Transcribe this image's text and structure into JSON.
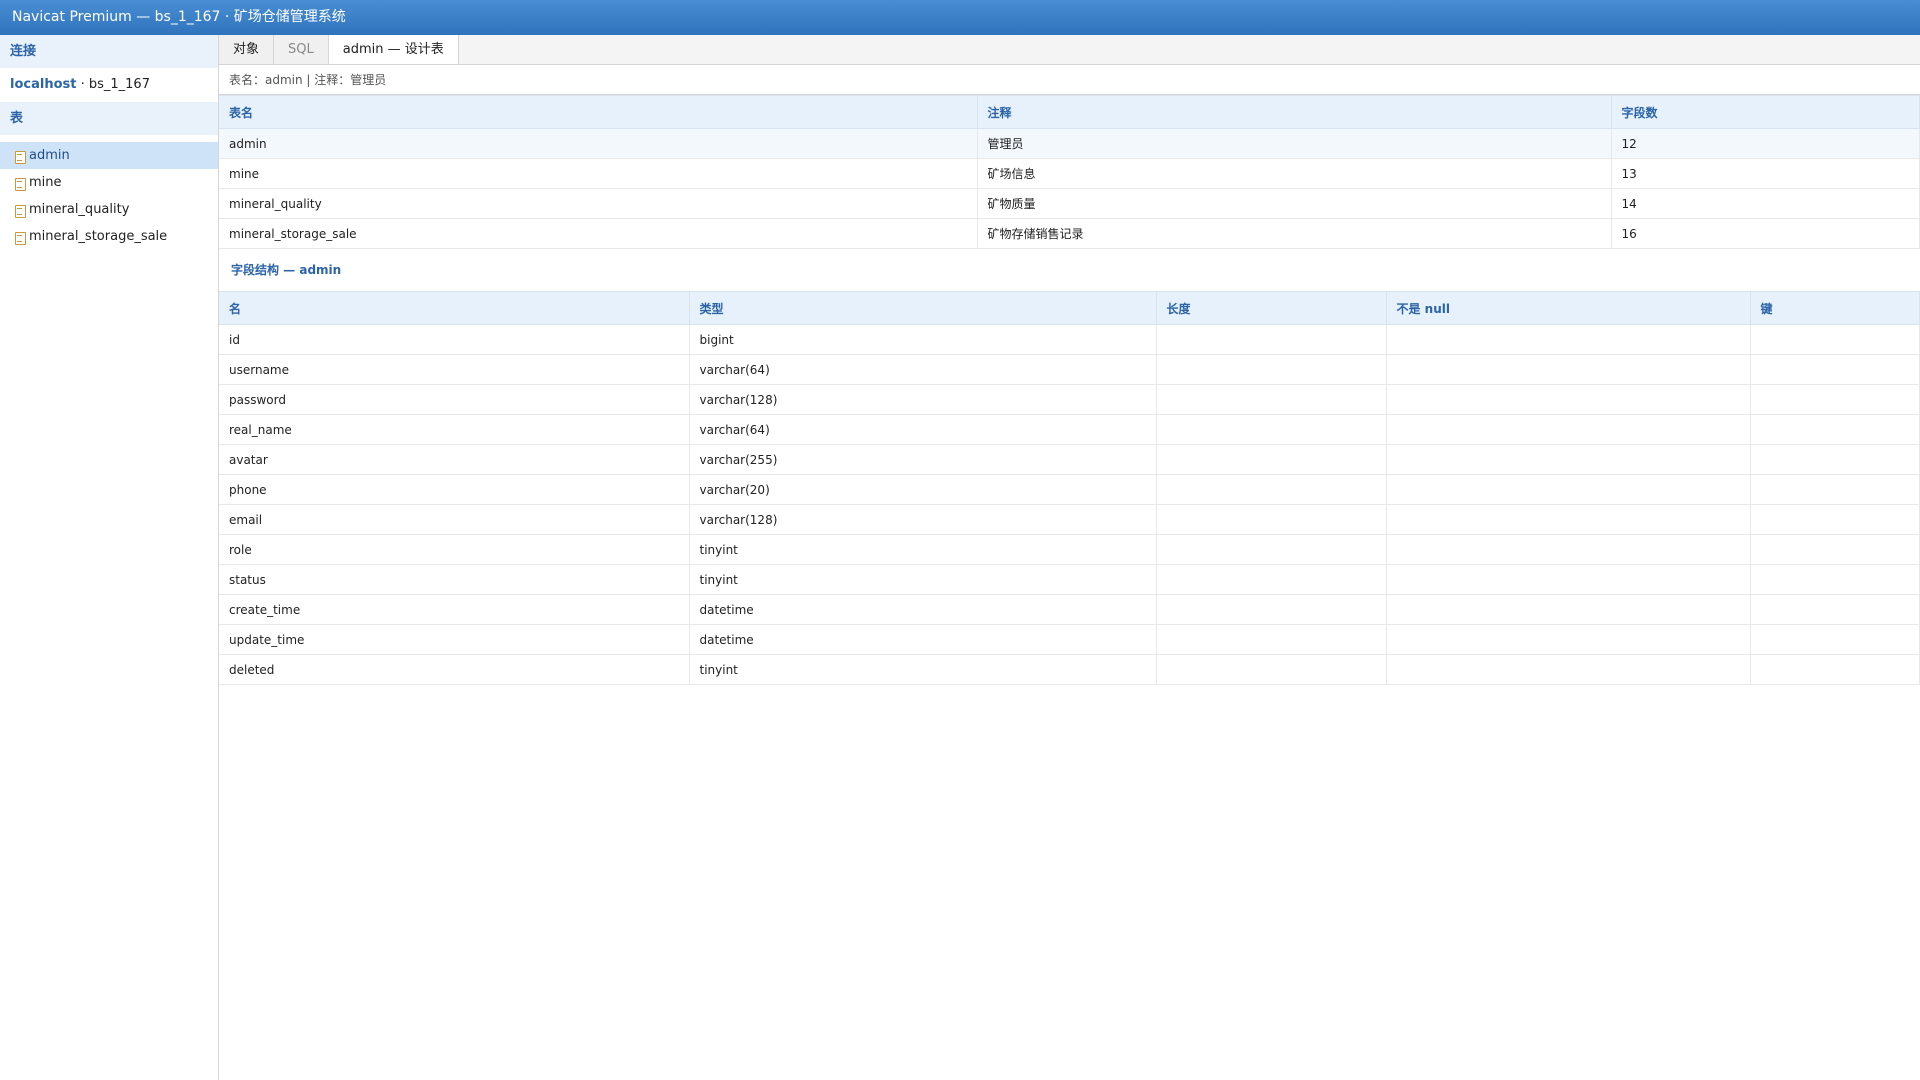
{
  "window": {
    "title": "Navicat Premium — bs_1_167 · 矿场仓储管理系统"
  },
  "sidebar": {
    "connection_header": "连接",
    "connection_host": "localhost",
    "connection_db": " · bs_1_167",
    "tables_header": "表",
    "tables": [
      {
        "label": "admin",
        "active": true
      },
      {
        "label": "mine"
      },
      {
        "label": "mineral_quality"
      },
      {
        "label": "mineral_storage_sale"
      }
    ]
  },
  "tabs": [
    {
      "label": "对象"
    },
    {
      "label": "SQL"
    },
    {
      "label": "admin — 设计表"
    }
  ],
  "infobar": "表名：admin  |  注释：管理员",
  "tables_grid": {
    "headers": [
      "表名",
      "注释",
      "字段数"
    ],
    "rows": [
      [
        "admin",
        "管理员",
        "12"
      ],
      [
        "mine",
        "矿场信息",
        "13"
      ],
      [
        "mineral_quality",
        "矿物质量",
        "14"
      ],
      [
        "mineral_storage_sale",
        "矿物存储销售记录",
        "16"
      ]
    ]
  },
  "fields_section_title": "字段结构 — admin",
  "fields_grid": {
    "headers": [
      "名",
      "类型",
      "长度",
      "不是 null",
      "键"
    ],
    "rows": [
      [
        "id",
        "bigint",
        "",
        "",
        ""
      ],
      [
        "username",
        "varchar(64)",
        "",
        "",
        ""
      ],
      [
        "password",
        "varchar(128)",
        "",
        "",
        ""
      ],
      [
        "real_name",
        "varchar(64)",
        "",
        "",
        ""
      ],
      [
        "avatar",
        "varchar(255)",
        "",
        "",
        ""
      ],
      [
        "phone",
        "varchar(20)",
        "",
        "",
        ""
      ],
      [
        "email",
        "varchar(128)",
        "",
        "",
        ""
      ],
      [
        "role",
        "tinyint",
        "",
        "",
        ""
      ],
      [
        "status",
        "tinyint",
        "",
        "",
        ""
      ],
      [
        "create_time",
        "datetime",
        "",
        "",
        ""
      ],
      [
        "update_time",
        "datetime",
        "",
        "",
        ""
      ],
      [
        "deleted",
        "tinyint",
        "",
        "",
        ""
      ]
    ]
  }
}
